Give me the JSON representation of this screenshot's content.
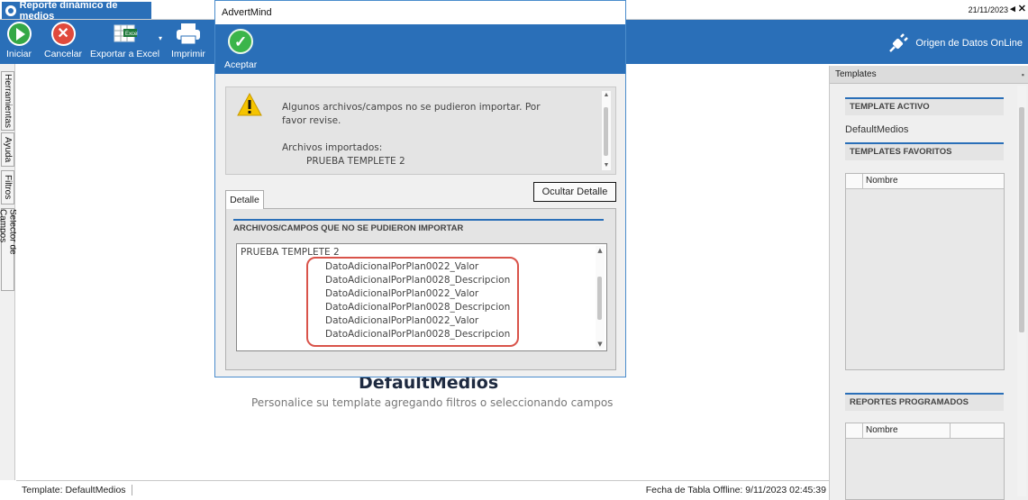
{
  "titlebar": {
    "doc_tab": "Reporte dinámico de medios",
    "date": "21/11/2023",
    "nav": "◂ ✕"
  },
  "ribbon": {
    "iniciar": "Iniciar",
    "cancelar": "Cancelar",
    "exportar": "Exportar a Excel",
    "imprimir": "Imprimir",
    "origen": "Origen de Datos OnLine"
  },
  "left_tabs": [
    "Herramientas",
    "Ayuda",
    "Filtros",
    "Selector de Campos"
  ],
  "main": {
    "title": "DefaultMedios",
    "subtitle": "Personalice su template agregando filtros o seleccionando campos"
  },
  "right_panel": {
    "header": "Templates",
    "template_activo_label": "TEMPLATE ACTIVO",
    "template_activo_value": "DefaultMedios",
    "favoritos_label": "TEMPLATES FAVORITOS",
    "favoritos_col": "Nombre",
    "programados_label": "REPORTES PROGRAMADOS",
    "programados_col": "Nombre"
  },
  "status": {
    "left": "Template: DefaultMedios",
    "right": "Fecha de Tabla Offline: 9/11/2023 02:45:39"
  },
  "dialog": {
    "title": "AdvertMind",
    "aceptar": "Aceptar",
    "msg_line1": "Algunos archivos/campos no se pudieron importar. Por",
    "msg_line2": "favor revise.",
    "msg_line3": "Archivos importados:",
    "msg_line4": "PRUEBA TEMPLETE 2",
    "ocultar": "Ocultar Detalle",
    "tab": "Detalle",
    "panel_header": "ARCHIVOS/CAMPOS QUE NO SE PUDIERON IMPORTAR",
    "list_head": "PRUEBA TEMPLETE 2",
    "items": [
      "DatoAdicionalPorPlan0022_Valor",
      "DatoAdicionalPorPlan0028_Descripcion",
      "DatoAdicionalPorPlan0022_Valor",
      "DatoAdicionalPorPlan0028_Descripcion",
      "DatoAdicionalPorPlan0022_Valor",
      "DatoAdicionalPorPlan0028_Descripcion"
    ]
  },
  "colors": {
    "ribbon": "#2a6fb8",
    "highlight": "#d9534a",
    "check": "#3bb54a"
  }
}
